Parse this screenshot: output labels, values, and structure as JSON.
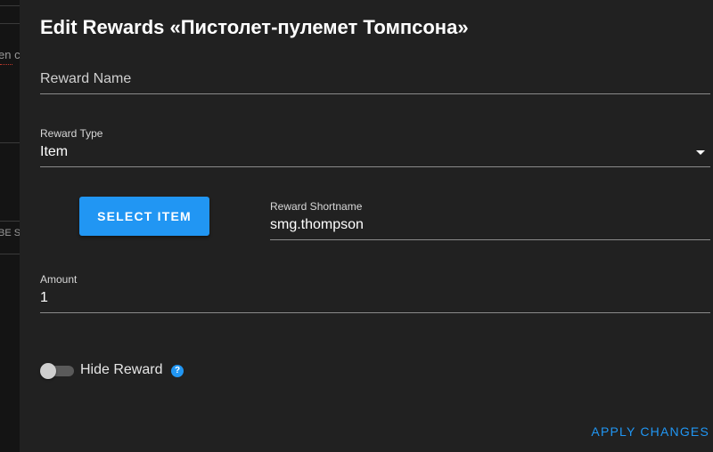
{
  "background_page": {
    "snippet_text": "en c",
    "button_snippet": "BE S"
  },
  "dialog": {
    "title": "Edit Rewards «Пистолет-пулемет Томпсона»",
    "reward_name": {
      "placeholder": "Reward Name",
      "value": ""
    },
    "reward_type": {
      "label": "Reward Type",
      "value": "Item"
    },
    "select_item_button": "SELECT ITEM",
    "reward_shortname": {
      "label": "Reward Shortname",
      "value": "smg.thompson"
    },
    "amount": {
      "label": "Amount",
      "value": "1"
    },
    "hide_reward": {
      "label": "Hide Reward",
      "enabled": false,
      "help_icon": "question-circle-icon"
    },
    "apply_button": "APPLY CHANGES"
  },
  "colors": {
    "accent": "#2196f3",
    "dialog_background": "#212121",
    "page_background": "#141414"
  }
}
